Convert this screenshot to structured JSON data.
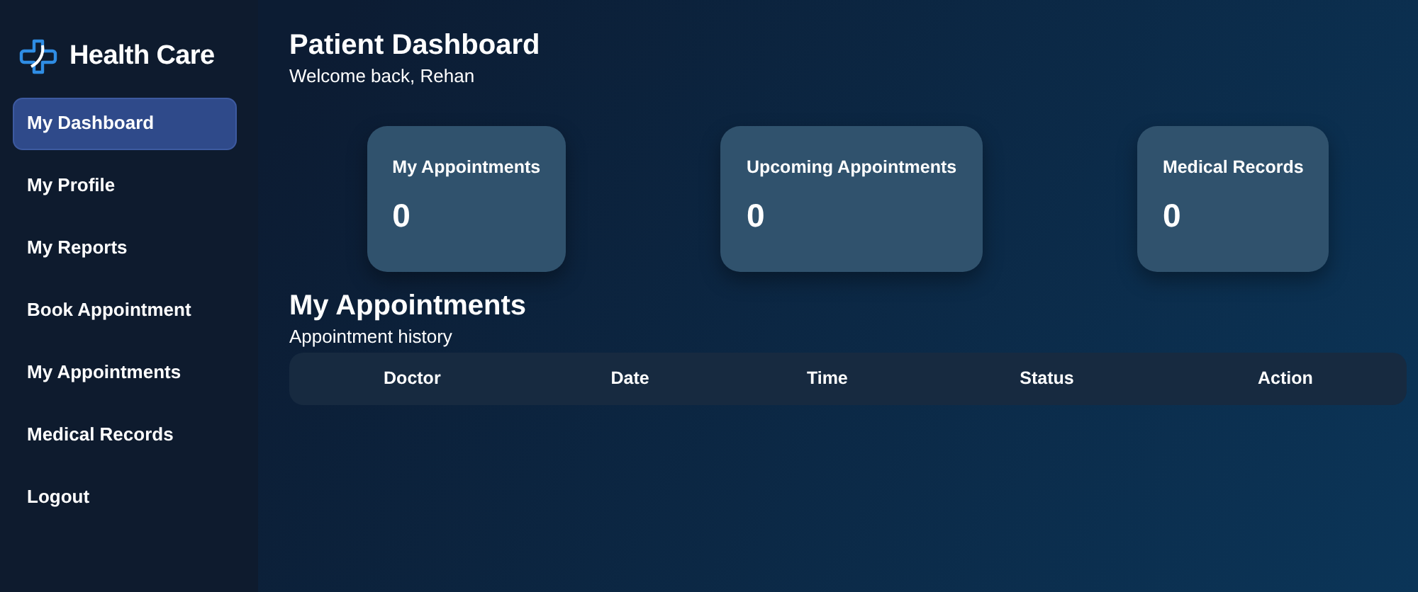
{
  "brand": {
    "name": "Health Care"
  },
  "sidebar": {
    "items": [
      {
        "label": "My Dashboard",
        "selected": true
      },
      {
        "label": "My Profile",
        "selected": false
      },
      {
        "label": "My Reports",
        "selected": false
      },
      {
        "label": "Book Appointment",
        "selected": false
      },
      {
        "label": "My Appointments",
        "selected": false
      },
      {
        "label": "Medical Records",
        "selected": false
      },
      {
        "label": "Logout",
        "selected": false
      }
    ]
  },
  "header": {
    "title": "Patient Dashboard",
    "subtitle": "Welcome back, Rehan"
  },
  "stats": [
    {
      "label": "My Appointments",
      "value": "0"
    },
    {
      "label": "Upcoming Appointments",
      "value": "0"
    },
    {
      "label": "Medical Records",
      "value": "0"
    }
  ],
  "appointments": {
    "title": "My Appointments",
    "subtitle": "Appointment history",
    "table": {
      "columns": [
        "Doctor",
        "Date",
        "Time",
        "Status",
        "Action"
      ]
    }
  }
}
